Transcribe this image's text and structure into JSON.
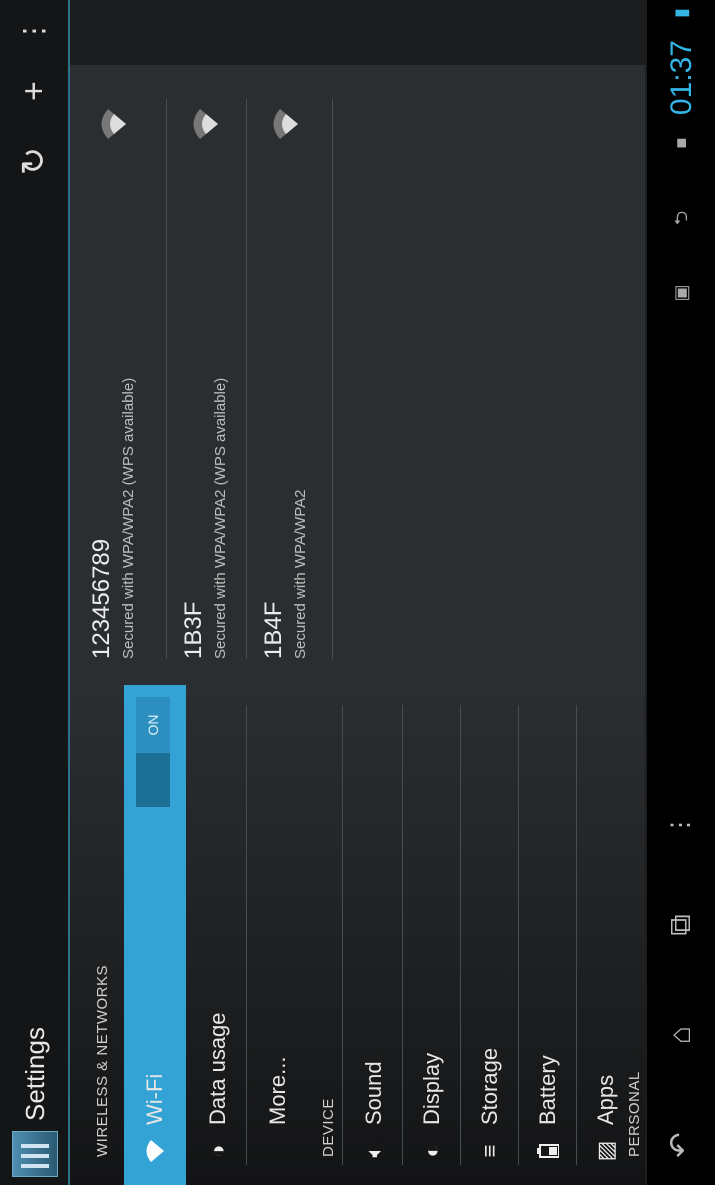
{
  "app": {
    "title": "Settings"
  },
  "sections": {
    "wireless": "WIRELESS & NETWORKS",
    "device": "DEVICE",
    "personal": "PERSONAL"
  },
  "menu": {
    "wifi": {
      "label": "Wi-Fi",
      "toggle": "ON"
    },
    "data_usage": "Data usage",
    "more": "More...",
    "sound": "Sound",
    "display": "Display",
    "storage": "Storage",
    "battery": "Battery",
    "apps": "Apps"
  },
  "networks": [
    {
      "ssid": "123456789",
      "security": "Secured with WPA/WPA2 (WPS available)"
    },
    {
      "ssid": "1B3F",
      "security": "Secured with WPA/WPA2 (WPS available)"
    },
    {
      "ssid": "1B4F",
      "security": "Secured with WPA/WPA2"
    }
  ],
  "status": {
    "time": "01:37"
  },
  "colors": {
    "accent": "#33b5e5",
    "selected": "#33a3d6"
  },
  "icons": [
    "settings-app-icon",
    "refresh-icon",
    "add-icon",
    "overflow-menu-icon",
    "wifi-icon",
    "data-usage-icon",
    "sound-icon",
    "display-icon",
    "storage-icon",
    "battery-icon",
    "apps-icon",
    "wifi-signal-icon",
    "back-icon",
    "home-icon",
    "recents-icon",
    "menu-icon",
    "usb-icon",
    "sd-card-icon",
    "screenshot-icon",
    "battery-status-icon"
  ]
}
